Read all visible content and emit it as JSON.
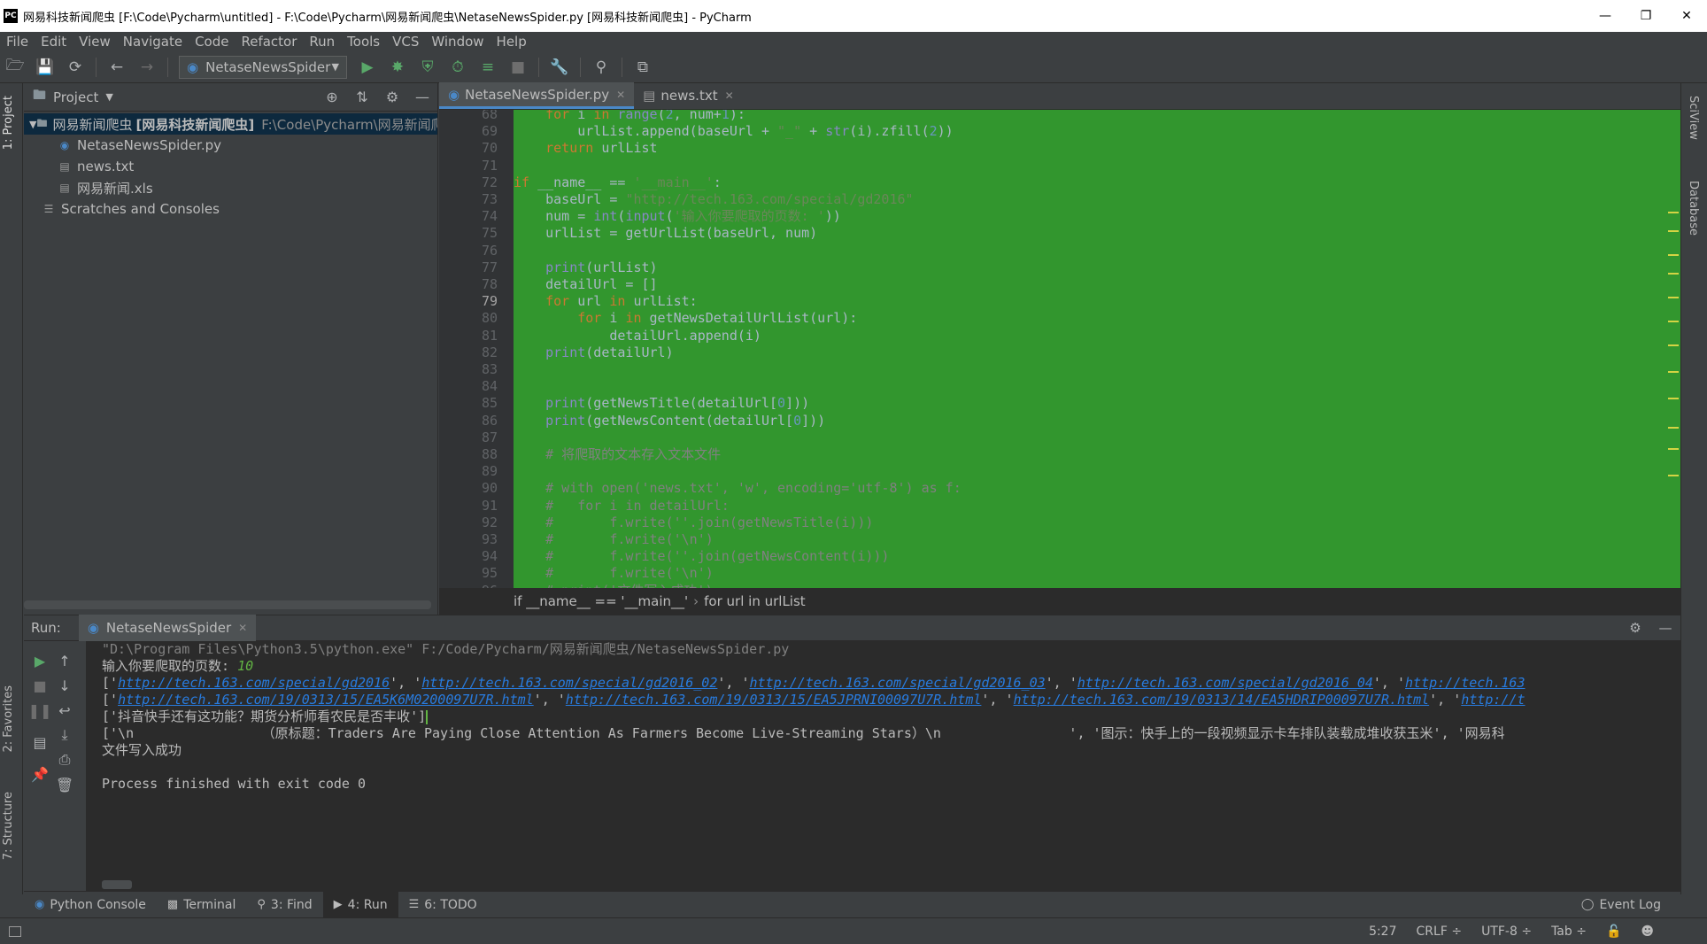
{
  "window": {
    "title": "网易科技新闻爬虫 [F:\\Code\\Pycharm\\untitled] - F:\\Code\\Pycharm\\网易新闻爬虫\\NetaseNewsSpider.py [网易科技新闻爬虫] - PyCharm",
    "app_icon": "PC"
  },
  "menu": [
    "File",
    "Edit",
    "View",
    "Navigate",
    "Code",
    "Refactor",
    "Run",
    "Tools",
    "VCS",
    "Window",
    "Help"
  ],
  "toolbar": {
    "run_config": "NetaseNewsSpider"
  },
  "left_strip": {
    "project_tab": "1: Project",
    "favorites_tab": "2: Favorites",
    "structure_tab": "7: Structure"
  },
  "right_strip": {
    "sciview_tab": "SciView",
    "database_tab": "Database"
  },
  "project": {
    "header": "Project",
    "root_name": "网易新闻爬虫",
    "root_bold": "[网易科技新闻爬虫]",
    "root_path": "F:\\Code\\Pycharm\\网易新闻爬虫",
    "files": [
      "NetaseNewsSpider.py",
      "news.txt",
      "网易新闻.xls"
    ],
    "scratches": "Scratches and Consoles"
  },
  "editor": {
    "tabs": [
      {
        "label": "NetaseNewsSpider.py",
        "active": true
      },
      {
        "label": "news.txt",
        "active": false
      }
    ],
    "current_line": "79",
    "breadcrumb": [
      "if __name__ == '__main__'",
      "for url in urlList"
    ]
  },
  "code_lines": [
    {
      "n": "68",
      "t": "    for i in range(2, num+1):"
    },
    {
      "n": "69",
      "t": "        urlList.append(baseUrl + \"_\" + str(i).zfill(2))"
    },
    {
      "n": "70",
      "t": "    return urlList"
    },
    {
      "n": "71",
      "t": ""
    },
    {
      "n": "72",
      "t": "if __name__ == '__main__':"
    },
    {
      "n": "73",
      "t": "    baseUrl = \"http://tech.163.com/special/gd2016\""
    },
    {
      "n": "74",
      "t": "    num = int(input('输入你要爬取的页数: '))"
    },
    {
      "n": "75",
      "t": "    urlList = getUrlList(baseUrl, num)"
    },
    {
      "n": "76",
      "t": ""
    },
    {
      "n": "77",
      "t": "    print(urlList)"
    },
    {
      "n": "78",
      "t": "    detailUrl = []"
    },
    {
      "n": "79",
      "t": "    for url in urlList:"
    },
    {
      "n": "80",
      "t": "        for i in getNewsDetailUrlList(url):"
    },
    {
      "n": "81",
      "t": "            detailUrl.append(i)"
    },
    {
      "n": "82",
      "t": "    print(detailUrl)"
    },
    {
      "n": "83",
      "t": ""
    },
    {
      "n": "84",
      "t": ""
    },
    {
      "n": "85",
      "t": "    print(getNewsTitle(detailUrl[0]))"
    },
    {
      "n": "86",
      "t": "    print(getNewsContent(detailUrl[0]))"
    },
    {
      "n": "87",
      "t": ""
    },
    {
      "n": "88",
      "t": "    # 将爬取的文本存入文本文件"
    },
    {
      "n": "89",
      "t": ""
    },
    {
      "n": "90",
      "t": "    # with open('news.txt', 'w', encoding='utf-8') as f:"
    },
    {
      "n": "91",
      "t": "    #   for i in detailUrl:"
    },
    {
      "n": "92",
      "t": "    #       f.write(''.join(getNewsTitle(i)))"
    },
    {
      "n": "93",
      "t": "    #       f.write('\\n')"
    },
    {
      "n": "94",
      "t": "    #       f.write(''.join(getNewsContent(i)))"
    },
    {
      "n": "95",
      "t": "    #       f.write('\\n')"
    },
    {
      "n": "96",
      "t": "    # print('文件写入成功')"
    }
  ],
  "run": {
    "label": "Run:",
    "tab": "NetaseNewsSpider",
    "cmd": "\"D:\\Program Files\\Python3.5\\python.exe\" F:/Code/Pycharm/网易新闻爬虫/NetaseNewsSpider.py",
    "prompt": "输入你要爬取的页数: ",
    "prompt_value": "10",
    "list1": {
      "p0": "['",
      "u1": "http://tech.163.com/special/gd2016",
      "p1": "', '",
      "u2": "http://tech.163.com/special/gd2016_02",
      "p2": "', '",
      "u3": "http://tech.163.com/special/gd2016_03",
      "p3": "', '",
      "u4": "http://tech.163.com/special/gd2016_04",
      "p4": "', '",
      "u5": "http://tech.163"
    },
    "list2": {
      "p0": "['",
      "u1": "http://tech.163.com/19/0313/15/EA5K6M0200097U7R.html",
      "p1": "', '",
      "u2": "http://tech.163.com/19/0313/15/EA5JPRNI00097U7R.html",
      "p2": "', '",
      "u3": "http://tech.163.com/19/0313/14/EA5HDRIP00097U7R.html",
      "p3": "', '",
      "u4": "http://t"
    },
    "title_line": "['抖音快手还有这功能？期货分析师看农民是否丰收']",
    "content_line": "['\\n                （原标题：Traders Are Paying Close Attention As Farmers Become Live-Streaming Stars）\\n                ', '图示：快手上的一段视频显示卡车排队装载成堆收获玉米', '网易科",
    "success": "文件写入成功",
    "exit": "Process finished with exit code 0"
  },
  "bottom_tabs": [
    "Python Console",
    "Terminal",
    "3: Find",
    "4: Run",
    "6: TODO"
  ],
  "event_log": "Event Log",
  "status": {
    "position": "5:27",
    "line_sep": "CRLF ÷",
    "encoding": "UTF-8 ÷",
    "indent": "Tab ÷"
  }
}
